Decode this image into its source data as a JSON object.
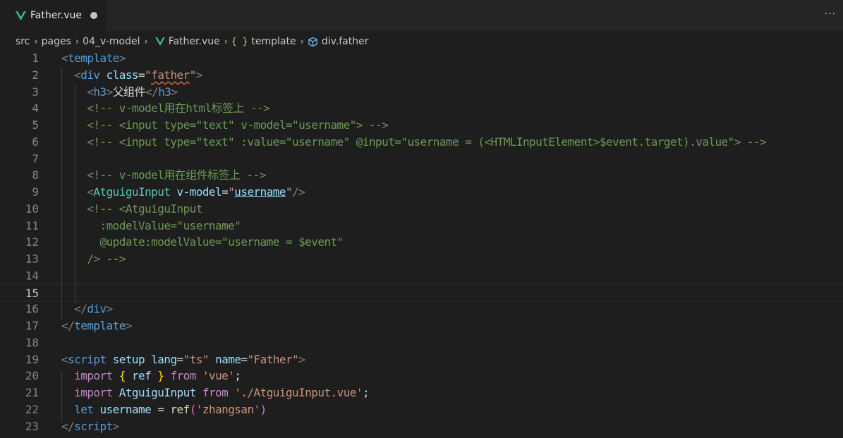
{
  "tab": {
    "label": "Father.vue",
    "more": "···"
  },
  "breadcrumb": {
    "src": "src",
    "pages": "pages",
    "folder": "04_v-model",
    "file": "Father.vue",
    "braces": "{ }",
    "template": "template",
    "element": "div.father"
  },
  "colors": {
    "vue_green": "#41b883",
    "comment": "#6a9955",
    "tag": "#569cd6",
    "string": "#ce9178"
  },
  "editor": {
    "active_line": 15,
    "line_numbers": [
      "1",
      "2",
      "3",
      "4",
      "5",
      "6",
      "7",
      "8",
      "9",
      "10",
      "11",
      "12",
      "13",
      "14",
      "15",
      "16",
      "17",
      "18",
      "19",
      "20",
      "21",
      "22",
      "23"
    ],
    "lines": [
      [
        [
          "punct",
          "<"
        ],
        [
          "tag",
          "template"
        ],
        [
          "punct",
          ">"
        ]
      ],
      [
        [
          "punct",
          "  <"
        ],
        [
          "tag",
          "div"
        ],
        [
          "text",
          " "
        ],
        [
          "attr",
          "class"
        ],
        [
          "text",
          "="
        ],
        [
          "str",
          "\""
        ],
        [
          "strsq",
          "father"
        ],
        [
          "str",
          "\""
        ],
        [
          "punct",
          ">"
        ]
      ],
      [
        [
          "punct",
          "    <"
        ],
        [
          "tag",
          "h3"
        ],
        [
          "punct",
          ">"
        ],
        [
          "text",
          "父组件"
        ],
        [
          "punct",
          "</"
        ],
        [
          "tag",
          "h3"
        ],
        [
          "punct",
          ">"
        ]
      ],
      [
        [
          "com",
          "    <!-- v-model用在html标签上 -->"
        ]
      ],
      [
        [
          "com",
          "    <!-- <input type=\"text\" v-model=\"username\"> -->"
        ]
      ],
      [
        [
          "com",
          "    <!-- <input type=\"text\" :value=\"username\" @input=\"username = (<HTMLInputElement>$event.target).value\"> -->"
        ]
      ],
      [],
      [
        [
          "com",
          "    <!-- v-model用在组件标签上 -->"
        ]
      ],
      [
        [
          "punct",
          "    <"
        ],
        [
          "comp",
          "AtguiguInput"
        ],
        [
          "text",
          " "
        ],
        [
          "attr",
          "v-model"
        ],
        [
          "text",
          "="
        ],
        [
          "str",
          "\""
        ],
        [
          "varlink",
          "username"
        ],
        [
          "str",
          "\""
        ],
        [
          "punct",
          "/>"
        ]
      ],
      [
        [
          "com",
          "    <!-- <AtguiguInput"
        ]
      ],
      [
        [
          "com",
          "      :modelValue=\"username\""
        ]
      ],
      [
        [
          "com",
          "      @update:modelValue=\"username = $event\""
        ]
      ],
      [
        [
          "com",
          "    /> -->"
        ]
      ],
      [],
      [],
      [
        [
          "punct",
          "  </"
        ],
        [
          "tag",
          "div"
        ],
        [
          "punct",
          ">"
        ]
      ],
      [
        [
          "punct",
          "</"
        ],
        [
          "tag",
          "template"
        ],
        [
          "punct",
          ">"
        ]
      ],
      [],
      [
        [
          "punct",
          "<"
        ],
        [
          "tag",
          "script"
        ],
        [
          "text",
          " "
        ],
        [
          "attr",
          "setup"
        ],
        [
          "text",
          " "
        ],
        [
          "attr",
          "lang"
        ],
        [
          "text",
          "="
        ],
        [
          "str",
          "\"ts\""
        ],
        [
          "text",
          " "
        ],
        [
          "attr",
          "name"
        ],
        [
          "text",
          "="
        ],
        [
          "str",
          "\"Father\""
        ],
        [
          "punct",
          ">"
        ]
      ],
      [
        [
          "text",
          "  "
        ],
        [
          "kw",
          "import"
        ],
        [
          "text",
          " "
        ],
        [
          "brace",
          "{"
        ],
        [
          "text",
          " "
        ],
        [
          "var",
          "ref"
        ],
        [
          "text",
          " "
        ],
        [
          "brace",
          "}"
        ],
        [
          "text",
          " "
        ],
        [
          "kw",
          "from"
        ],
        [
          "text",
          " "
        ],
        [
          "str",
          "'vue'"
        ],
        [
          "text",
          ";"
        ]
      ],
      [
        [
          "text",
          "  "
        ],
        [
          "kw",
          "import"
        ],
        [
          "text",
          " "
        ],
        [
          "var",
          "AtguiguInput"
        ],
        [
          "text",
          " "
        ],
        [
          "kw",
          "from"
        ],
        [
          "text",
          " "
        ],
        [
          "str",
          "'./AtguiguInput.vue'"
        ],
        [
          "text",
          ";"
        ]
      ],
      [
        [
          "text",
          "  "
        ],
        [
          "blue",
          "let"
        ],
        [
          "text",
          " "
        ],
        [
          "var",
          "username"
        ],
        [
          "text",
          " = "
        ],
        [
          "fn",
          "ref"
        ],
        [
          "paren",
          "("
        ],
        [
          "str",
          "'zhangsan'"
        ],
        [
          "paren",
          ")"
        ]
      ],
      [
        [
          "punct",
          "</"
        ],
        [
          "tag",
          "script"
        ],
        [
          "punct",
          ">"
        ]
      ]
    ]
  }
}
